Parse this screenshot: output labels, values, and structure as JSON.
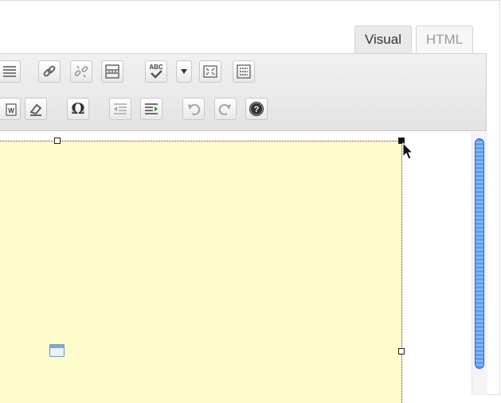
{
  "tabs": {
    "visual_label": "Visual",
    "html_label": "HTML"
  },
  "toolbar": {
    "row1": [
      "align-justify-icon",
      "link-icon",
      "unlink-icon",
      "more-tag-icon",
      "spellcheck-icon",
      "spellcheck-dropdown-icon",
      "fullscreen-icon",
      "kitchen-sink-icon"
    ],
    "row2": [
      "paste-word-icon",
      "eraser-icon",
      "omega-icon",
      "outdent-icon",
      "indent-icon",
      "undo-icon",
      "redo-icon",
      "help-icon"
    ],
    "spellcheck_text": "ABC",
    "omega_symbol": "Ω"
  },
  "colors": {
    "selection_fill": "#fffccc",
    "selection_border": "#8b1a1a",
    "scroll_thumb": "#5d9cf0"
  }
}
